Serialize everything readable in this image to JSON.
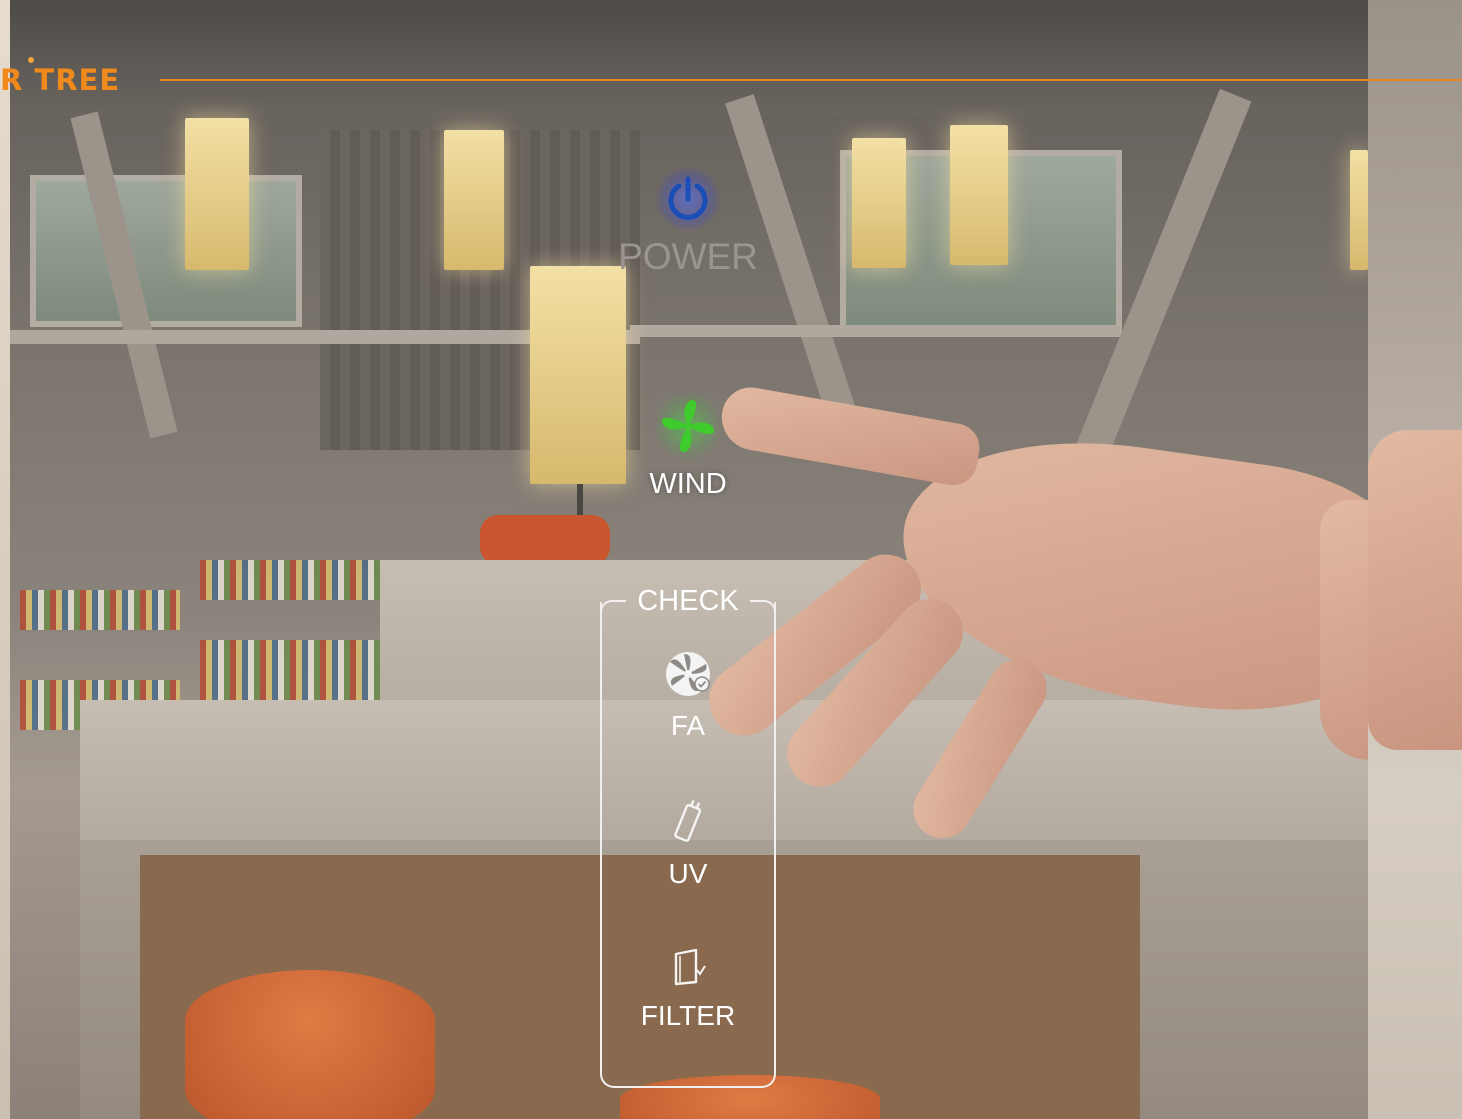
{
  "header": {
    "logo_text": "R TREE",
    "accent_color": "#E8841B"
  },
  "controls": {
    "power": {
      "label": "POWER",
      "icon": "power-icon",
      "color": "#1B4FB8"
    },
    "wind": {
      "label": "WIND",
      "icon": "pinwheel-fan-icon",
      "color": "#3FCB2E"
    }
  },
  "check_panel": {
    "title": "CHECK",
    "items": [
      {
        "label": "FA",
        "icon": "fan-check-icon"
      },
      {
        "label": "UV",
        "icon": "uv-lamp-icon"
      },
      {
        "label": "FILTER",
        "icon": "filter-check-icon"
      }
    ]
  }
}
